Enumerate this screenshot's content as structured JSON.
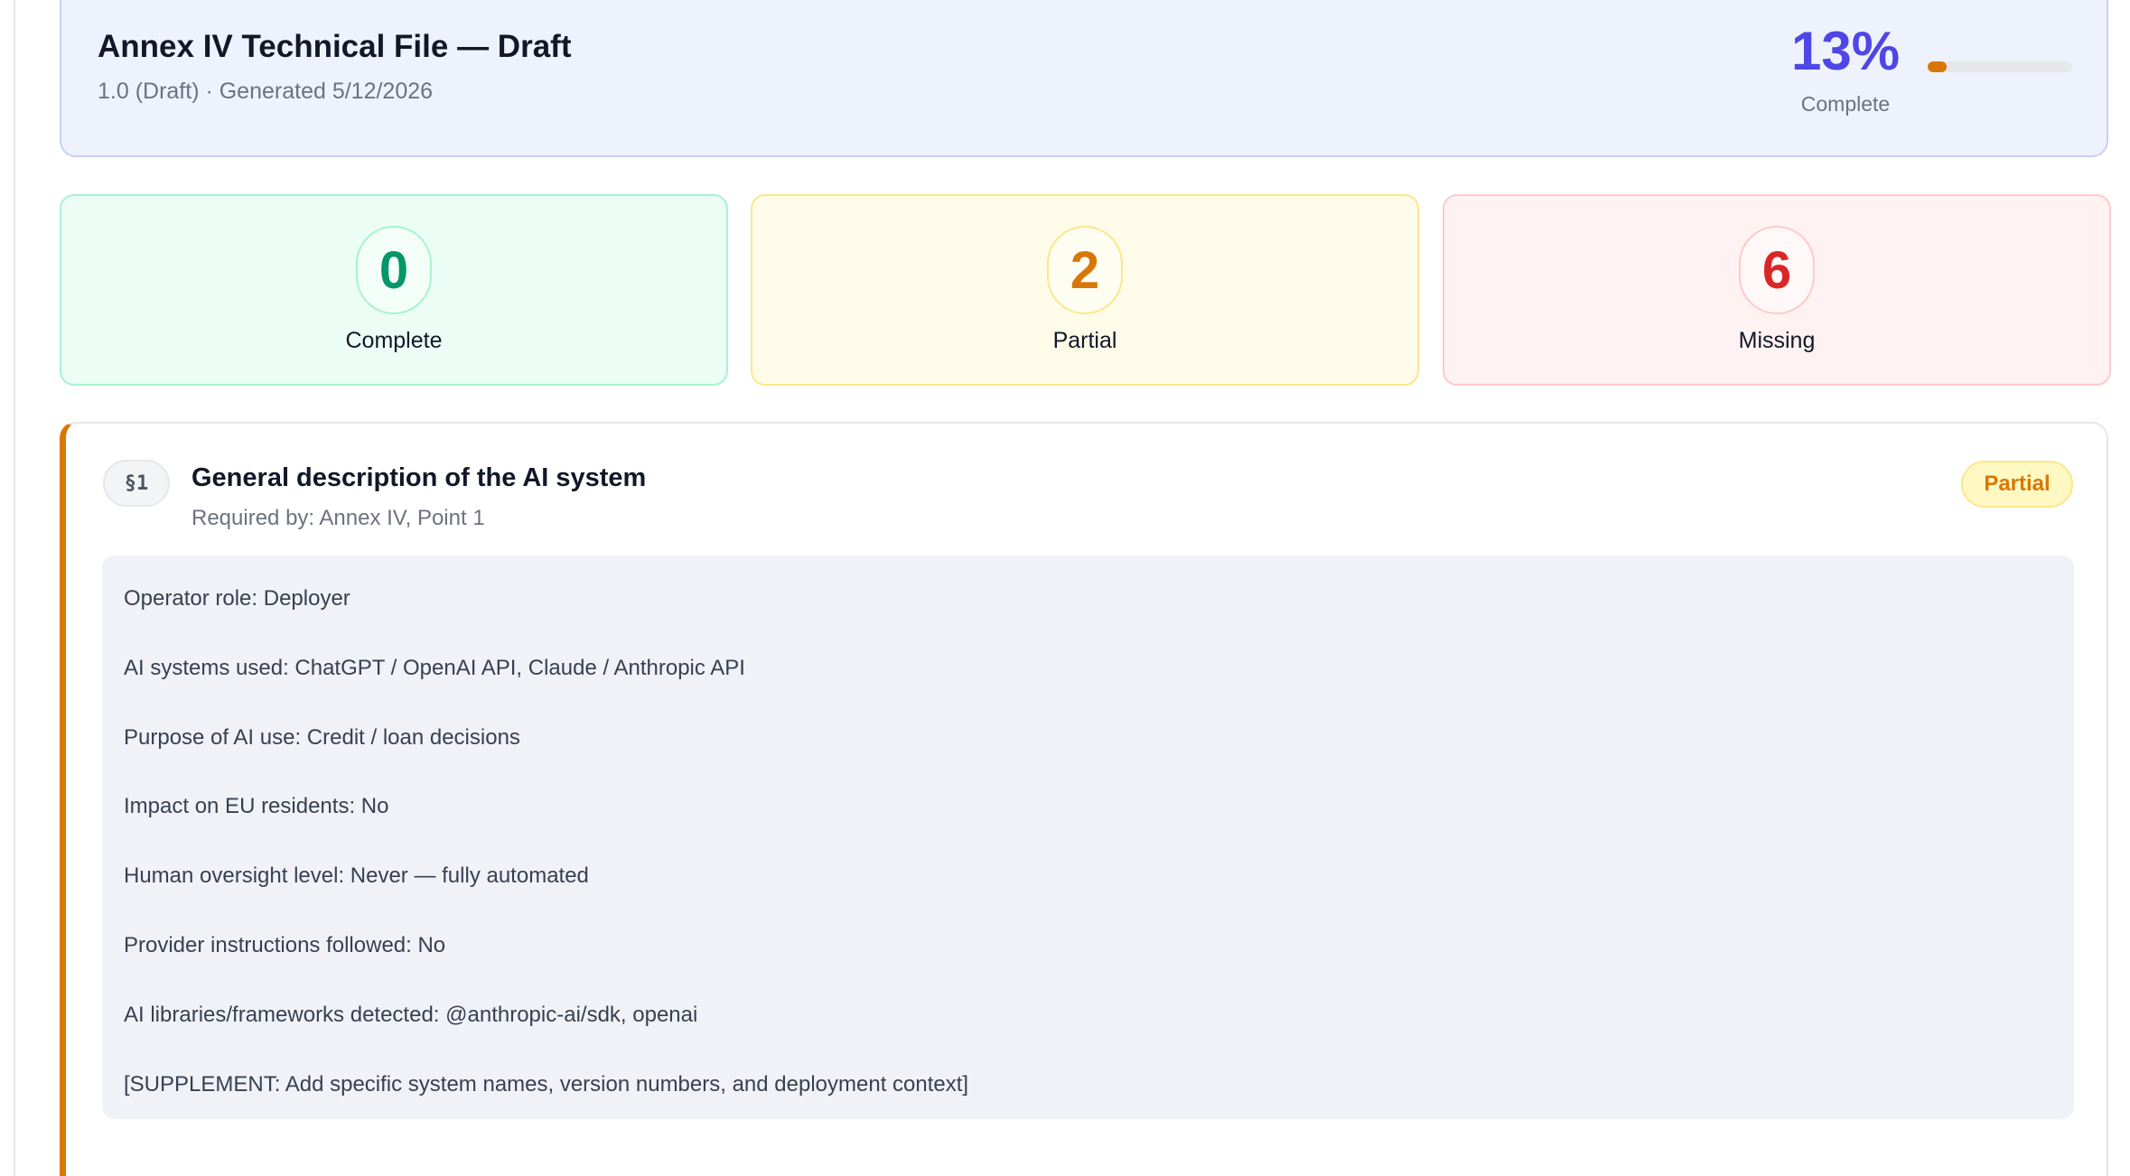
{
  "header": {
    "title": "Annex IV Technical File — Draft",
    "subtitle": "1.0 (Draft) · Generated 5/12/2026",
    "percent_text": "13%",
    "percent_label": "Complete",
    "progress_fraction": 0.13,
    "accent_color": "#4f46e5",
    "progress_color": "#d97706"
  },
  "stats": {
    "complete": {
      "count": "0",
      "label": "Complete",
      "color": "#059669"
    },
    "partial": {
      "count": "2",
      "label": "Partial",
      "color": "#d97706"
    },
    "missing": {
      "count": "6",
      "label": "Missing",
      "color": "#dc2626"
    }
  },
  "section": {
    "number": "§1",
    "title": "General description of the AI system",
    "required_by": "Required by: Annex IV, Point 1",
    "status": "Partial",
    "status_color": "#d97706",
    "lines": [
      "Operator role: Deployer",
      "AI systems used: ChatGPT / OpenAI API, Claude / Anthropic API",
      "Purpose of AI use: Credit / loan decisions",
      "Impact on EU residents: No",
      "Human oversight level: Never — fully automated",
      "Provider instructions followed: No",
      "AI libraries/frameworks detected: @anthropic-ai/sdk, openai",
      "[SUPPLEMENT: Add specific system names, version numbers, and deployment context]"
    ]
  }
}
